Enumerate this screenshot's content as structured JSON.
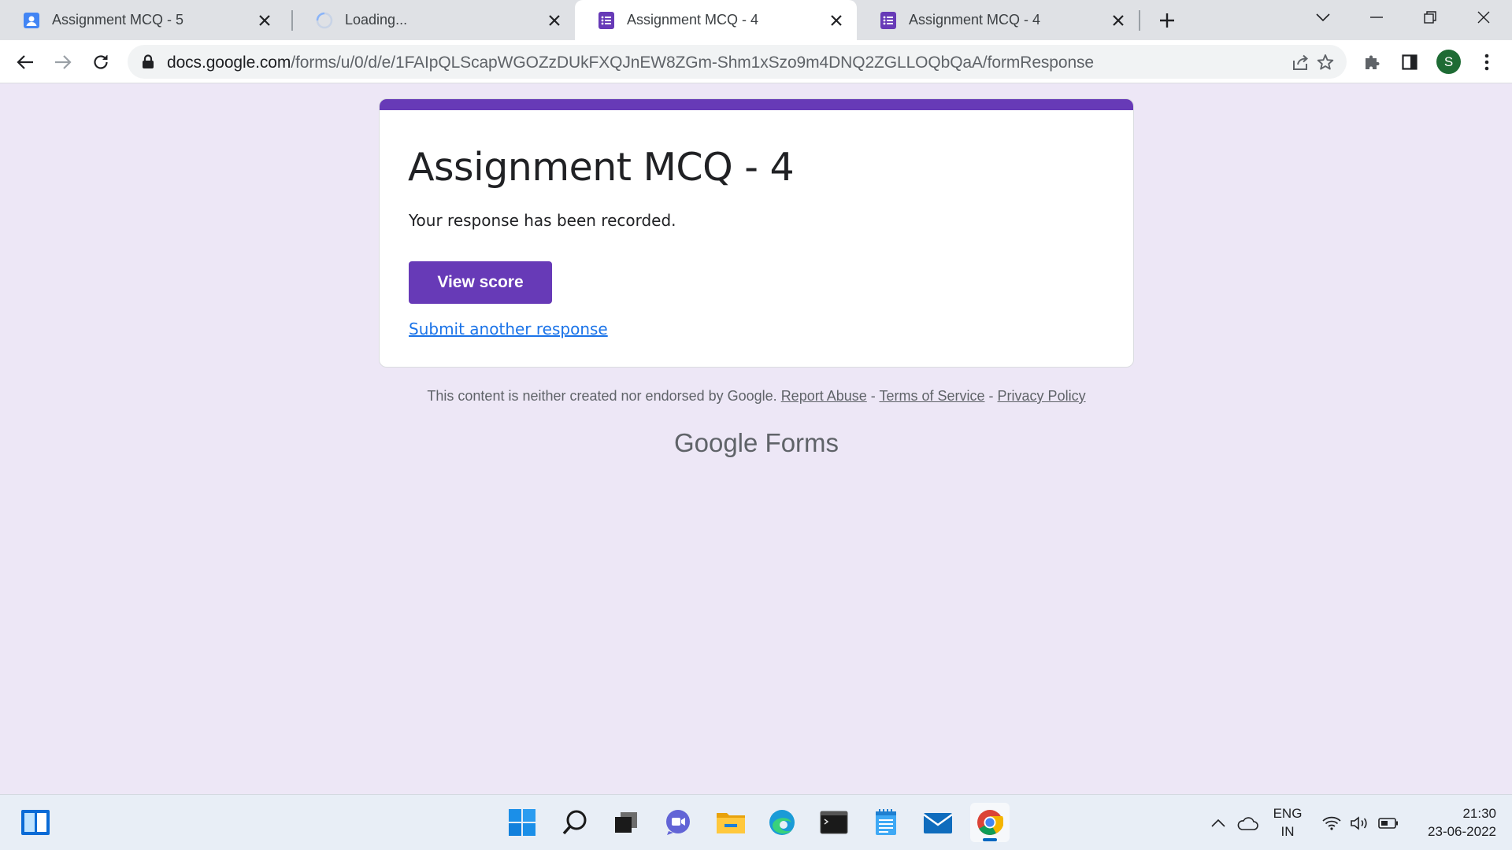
{
  "browser": {
    "tabs": [
      {
        "title": "Assignment MCQ - 5",
        "favicon": "contacts-icon",
        "active": false
      },
      {
        "title": "Loading...",
        "favicon": "loading-spinner-icon",
        "active": false
      },
      {
        "title": "Assignment MCQ - 4",
        "favicon": "google-forms-icon",
        "active": true
      },
      {
        "title": "Assignment MCQ - 4",
        "favicon": "google-forms-icon",
        "active": false
      }
    ],
    "url_domain": "docs.google.com",
    "url_path": "/forms/u/0/d/e/1FAIpQLScapWGOZzDUkFXQJnEW8ZGm-Shm1xSzo9m4DNQ2ZGLLOQbQaA/formResponse",
    "profile_initial": "S",
    "accent_color": "#673ab7"
  },
  "form": {
    "title": "Assignment MCQ - 4",
    "confirmation": "Your response has been recorded.",
    "view_score_label": "View score",
    "submit_another_label": "Submit another response"
  },
  "footer": {
    "disclaimer": "This content is neither created nor endorsed by Google.",
    "report_abuse": "Report Abuse",
    "separator": "-",
    "terms": "Terms of Service",
    "privacy": "Privacy Policy",
    "brand_google": "Google",
    "brand_forms": "Forms"
  },
  "taskbar": {
    "apps": [
      "start-icon",
      "search-icon",
      "task-view-icon",
      "chat-icon",
      "file-explorer-icon",
      "edge-icon",
      "terminal-icon",
      "notepad-icon",
      "mail-icon",
      "chrome-icon"
    ],
    "language_line1": "ENG",
    "language_line2": "IN",
    "time": "21:30",
    "date": "23-06-2022"
  }
}
